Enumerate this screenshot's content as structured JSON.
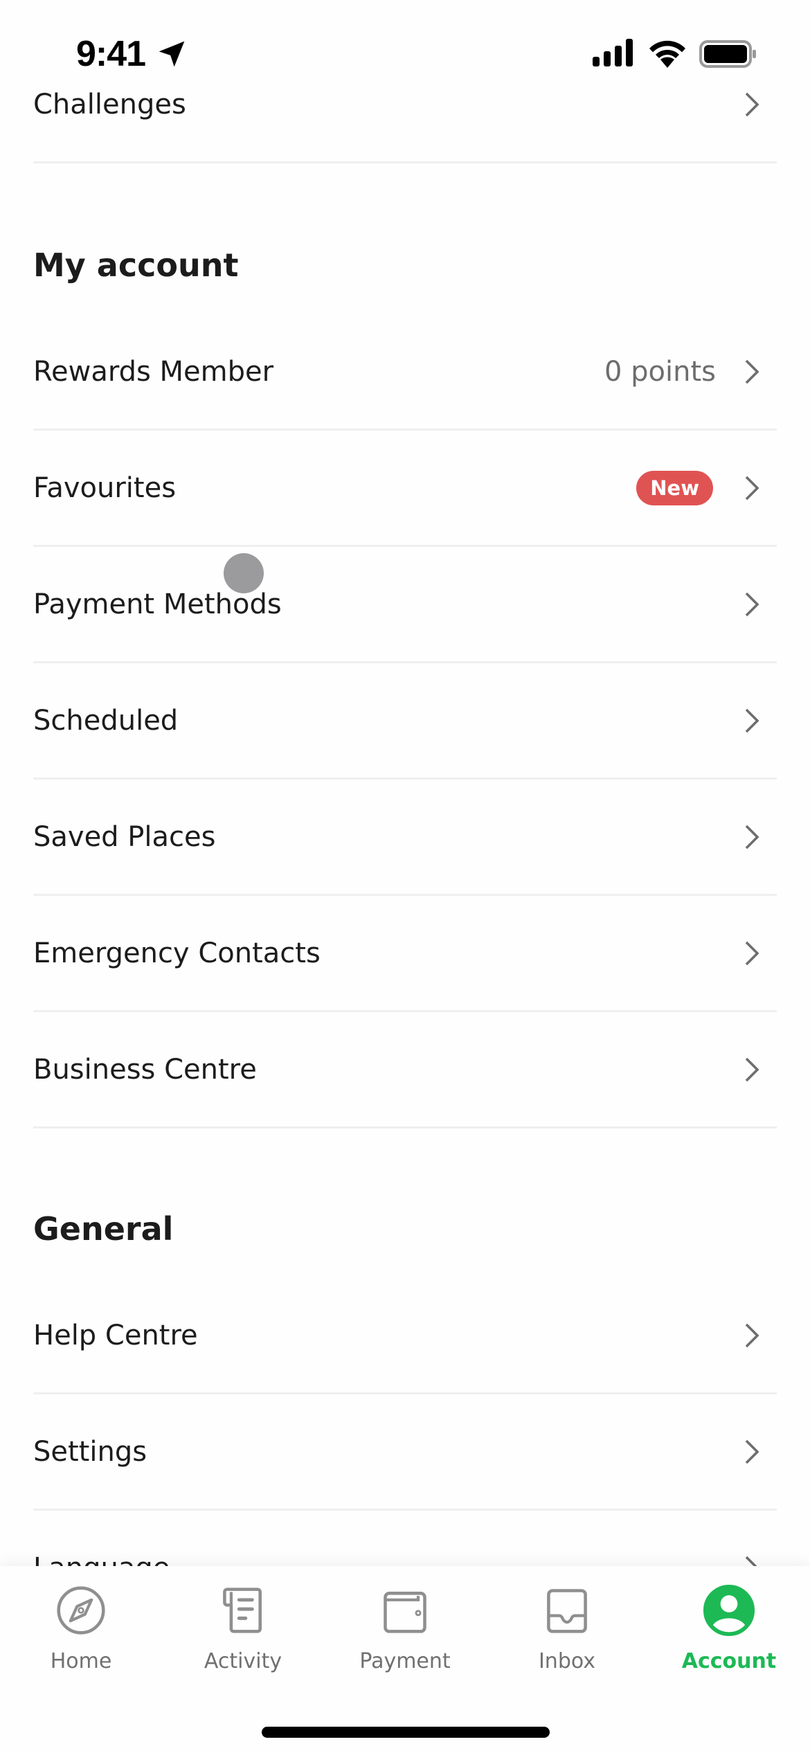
{
  "status_bar": {
    "time": "9:41"
  },
  "rows_top": [
    {
      "label": "Challenges"
    }
  ],
  "sections": [
    {
      "title": "My account",
      "items": [
        {
          "label": "Rewards Member",
          "value": "0 points"
        },
        {
          "label": "Favourites",
          "badge": "New"
        },
        {
          "label": "Payment Methods"
        },
        {
          "label": "Scheduled"
        },
        {
          "label": "Saved Places"
        },
        {
          "label": "Emergency Contacts"
        },
        {
          "label": "Business Centre"
        }
      ]
    },
    {
      "title": "General",
      "items": [
        {
          "label": "Help Centre"
        },
        {
          "label": "Settings"
        },
        {
          "label": "Language"
        }
      ]
    }
  ],
  "tab_bar": {
    "tabs": [
      {
        "label": "Home",
        "icon": "compass-icon"
      },
      {
        "label": "Activity",
        "icon": "receipt-icon"
      },
      {
        "label": "Payment",
        "icon": "wallet-icon"
      },
      {
        "label": "Inbox",
        "icon": "inbox-icon"
      },
      {
        "label": "Account",
        "icon": "account-icon",
        "active": true
      }
    ]
  },
  "colors": {
    "accent": "#1db955",
    "badge": "#e05353",
    "inactive": "#707070"
  }
}
